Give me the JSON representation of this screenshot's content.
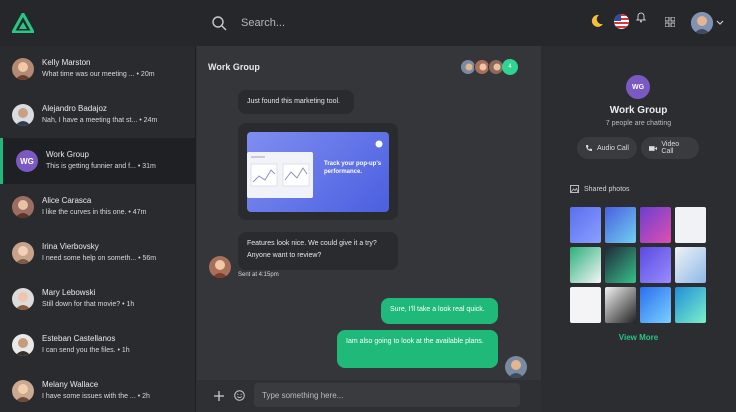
{
  "topbar": {
    "search_placeholder": "Search...",
    "icons": [
      "logo-icon",
      "search-icon",
      "moon-icon",
      "flag-icon",
      "bell-icon",
      "grid-icon",
      "chevron-down-icon"
    ]
  },
  "contacts": [
    {
      "name": "Kelly Marston",
      "message": "What time was our meeting ...",
      "time": " • 20m"
    },
    {
      "name": "Alejandro Badajoz",
      "message": "Nah, I have a meeting that st...",
      "time": " • 24m"
    },
    {
      "name": "Work Group",
      "initials": "WG",
      "message": "This is getting funnier and f...",
      "time": " • 31m"
    },
    {
      "name": "Alice Carasca",
      "message": "I like the curves in this one.",
      "time": " • 47m"
    },
    {
      "name": "Irina Vierbovsky",
      "message": "I need some help on someth...",
      "time": " • 56m"
    },
    {
      "name": "Mary Lebowski",
      "message": "Still down for that movie?",
      "time": " • 1h"
    },
    {
      "name": "Esteban Castellanos",
      "message": "I can send you the files.",
      "time": " • 1h"
    },
    {
      "name": "Melany Wallace",
      "message": "I have some issues with the ...",
      "time": " • 2h"
    }
  ],
  "chat": {
    "title": "Work Group",
    "member_count": "4",
    "messages": [
      "Just found this marketing tool.",
      "Features look nice. We could give it a try? Anyone want to review?",
      "Sure, I'll take a look real quick.",
      "Iam also going to look at the available plans."
    ],
    "promo_text": "Track your pop-up's performance.",
    "sent_time": "Sent at 4:15pm",
    "input_placeholder": "Type something here..."
  },
  "info": {
    "initials": "WG",
    "title": "Work Group",
    "subtitle": "7 people are chatting",
    "audio_call": "Audio Call",
    "video_call": "Video Call",
    "shared_photos": "Shared photos",
    "view_more": "View More"
  },
  "colors": {
    "accent": "#1fb97a",
    "group": "#7a5ac2",
    "background": "#2f3033"
  }
}
